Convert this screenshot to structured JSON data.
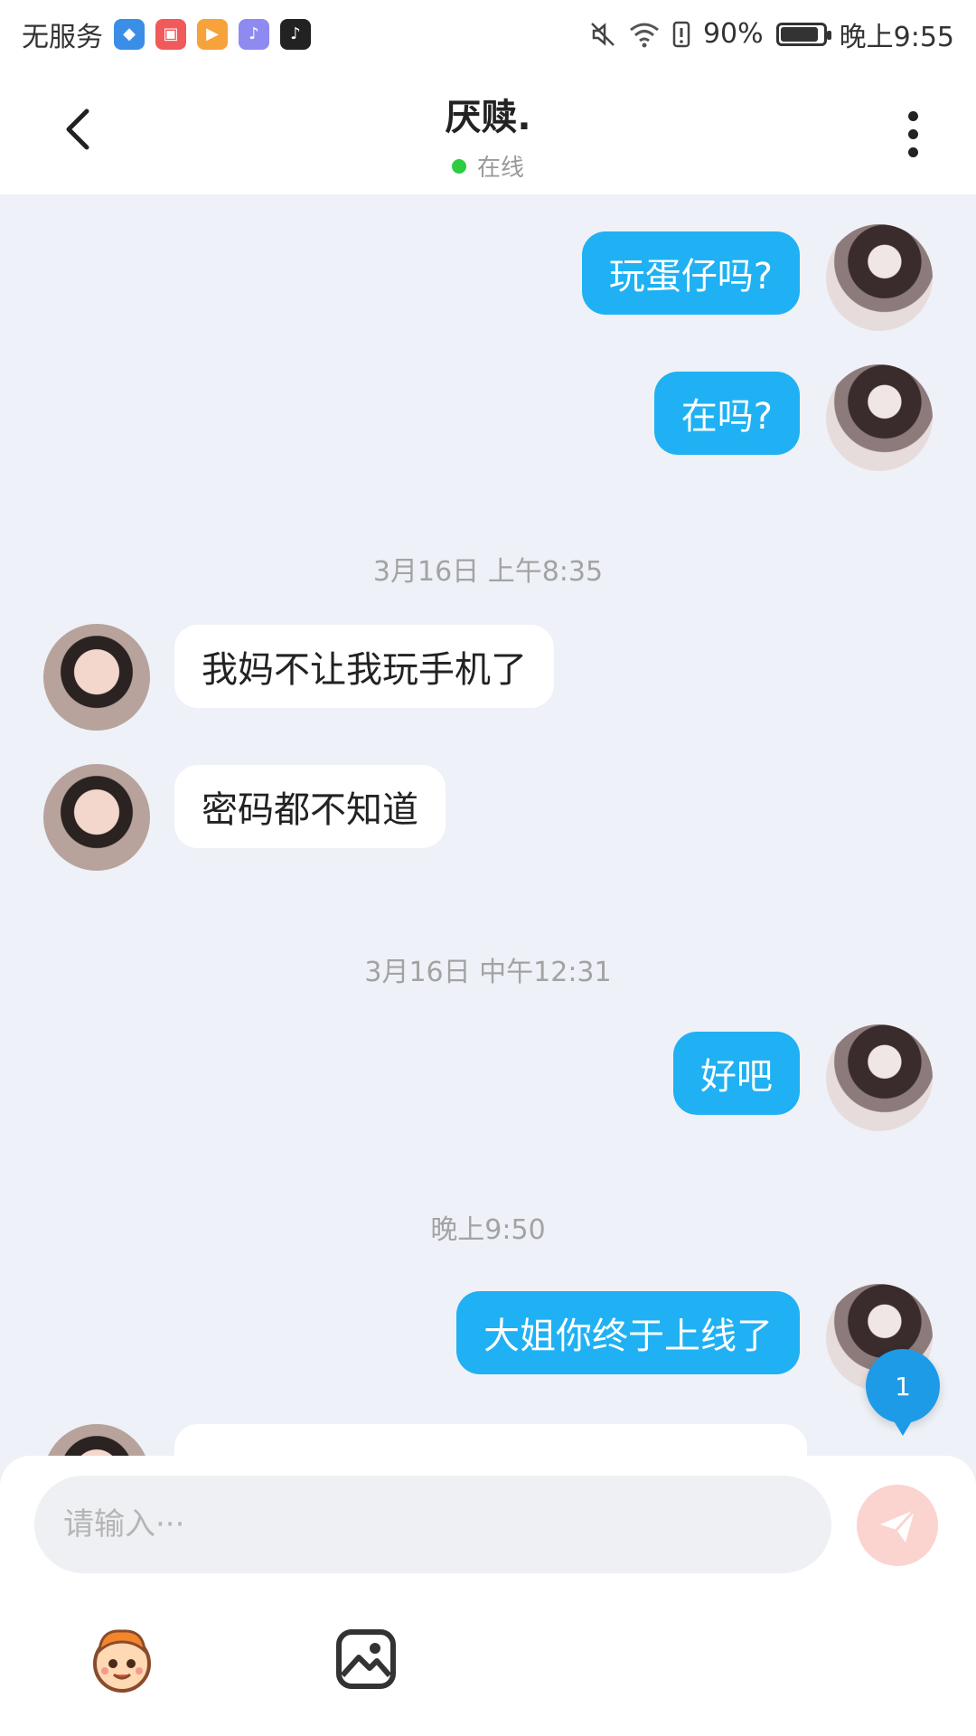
{
  "status_bar": {
    "carrier": "无服务",
    "battery_percent": "90%",
    "battery_level": 0.9,
    "time": "晚上9:55",
    "app_icons": [
      "shield-app-icon",
      "huawei-store-icon",
      "video-app-icon",
      "music-app-icon",
      "tiktok-icon"
    ]
  },
  "header": {
    "title": "厌赎.",
    "status": "在线",
    "status_color": "#2ecc40"
  },
  "messages": [
    {
      "side": "me",
      "text": "玩蛋仔吗?"
    },
    {
      "side": "me",
      "text": "在吗?"
    },
    {
      "type": "time",
      "text": "3月16日  上午8:35"
    },
    {
      "side": "them",
      "text": "我妈不让我玩手机了"
    },
    {
      "side": "them",
      "text": "密码都不知道"
    },
    {
      "type": "time",
      "text": "3月16日  中午12:31"
    },
    {
      "side": "me",
      "text": "好吧"
    },
    {
      "type": "time",
      "text": "晚上9:50"
    },
    {
      "side": "me",
      "text": "大姐你终于上线了"
    }
  ],
  "unread_badge": "1",
  "input": {
    "placeholder": "请输入···",
    "value": ""
  },
  "colors": {
    "my_bubble": "#1fb1f3",
    "their_bubble": "#ffffff",
    "send_button": "#fbd3cf",
    "background": "#eef1f7"
  },
  "toolbar_icons": [
    "emoji-face-icon",
    "image-icon"
  ]
}
